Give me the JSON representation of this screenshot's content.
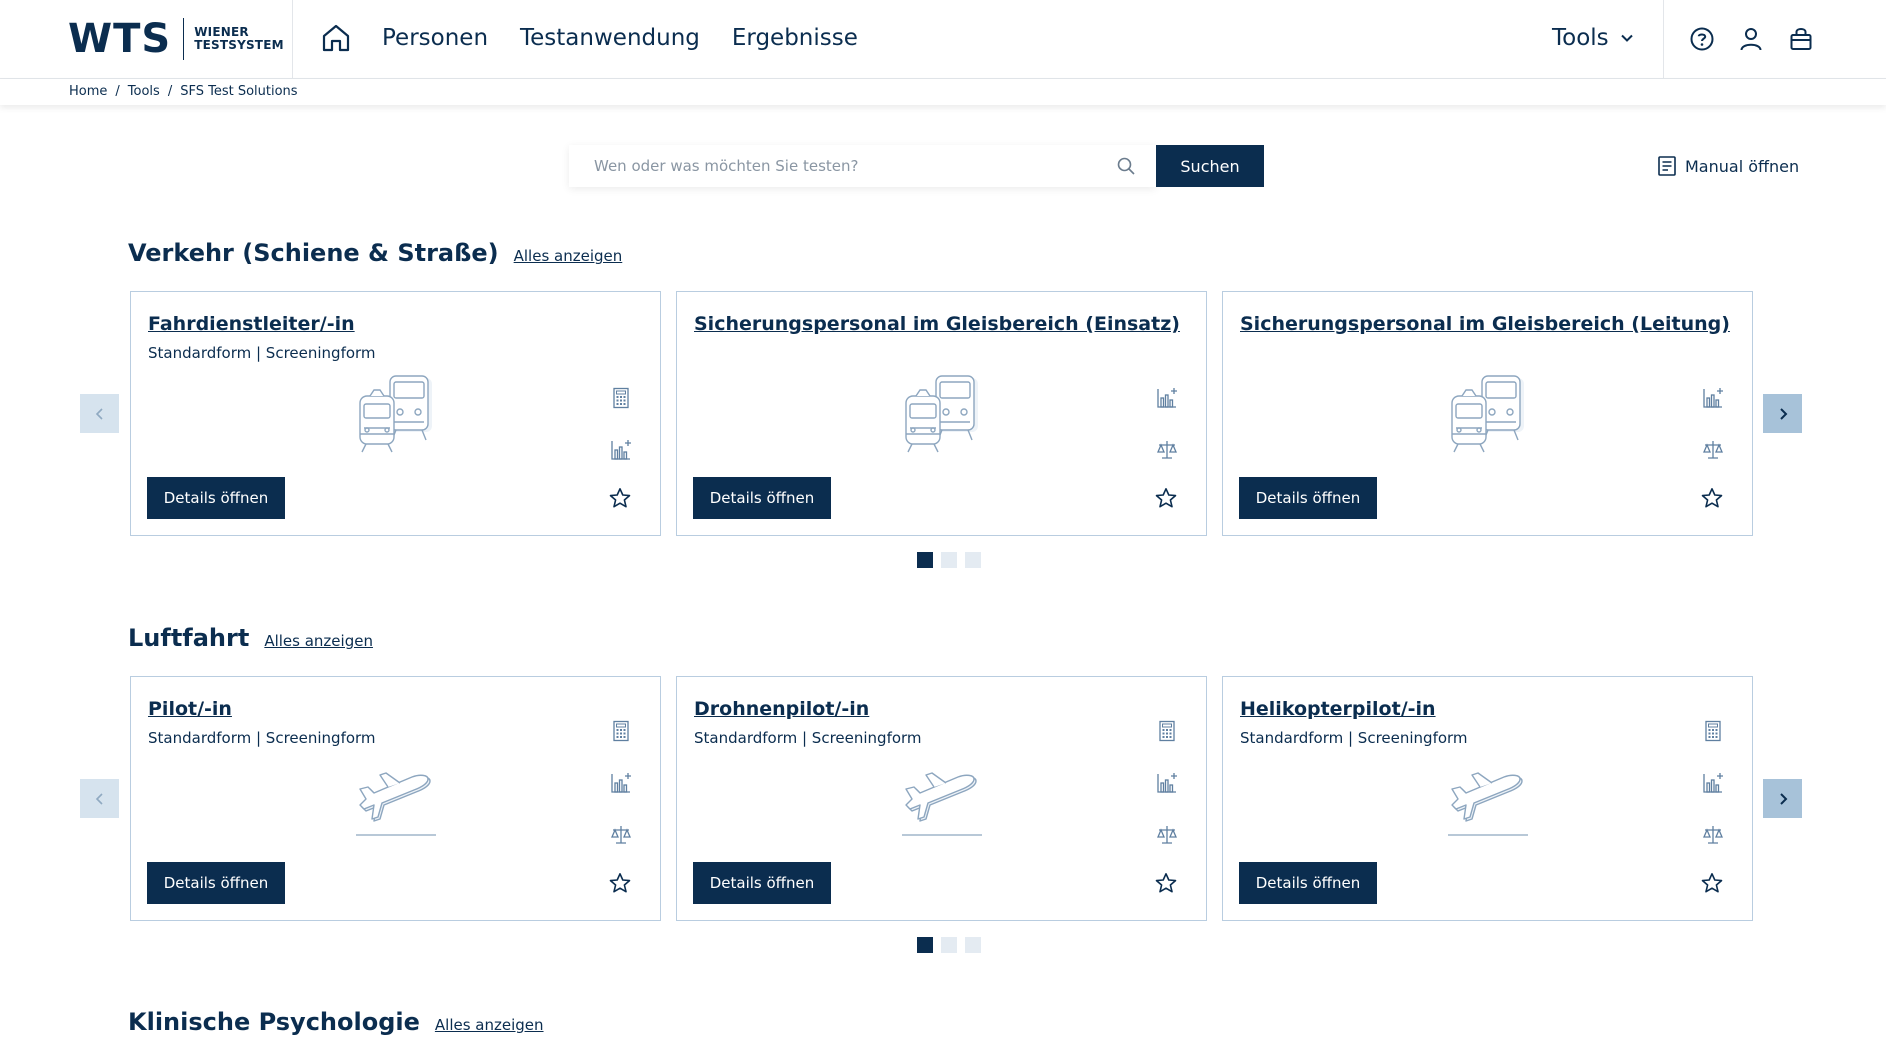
{
  "header": {
    "logo_main": "WTS",
    "logo_sub_line1": "WIENER",
    "logo_sub_line2": "TESTSYSTEM",
    "nav": [
      "Personen",
      "Testanwendung",
      "Ergebnisse"
    ],
    "tools_label": "Tools",
    "icons": [
      "home-icon",
      "help-icon",
      "user-icon",
      "cart-icon",
      "chevron-down-icon"
    ]
  },
  "breadcrumb": {
    "items": [
      "Home",
      "Tools",
      "SFS Test Solutions"
    ],
    "separator": "/"
  },
  "search": {
    "placeholder": "Wen oder was möchten Sie testen?",
    "value": "",
    "button_label": "Suchen",
    "manual_label": "Manual öffnen"
  },
  "colors": {
    "primary": "#0b2d4f",
    "card_border": "#b9cde0",
    "arrow_prev_bg": "#d6e3ee",
    "arrow_next_bg": "#a7c2d9",
    "dot_inactive": "#e4ebf2"
  },
  "sections": [
    {
      "title": "Verkehr (Schiene & Straße)",
      "link": "Alles anzeigen",
      "active_page": 1,
      "page_count": 3,
      "cards": [
        {
          "title": "Fahrdienstleiter/-in",
          "subtitle": "Standardform | Screeningform",
          "image": "train-icon",
          "button": "Details öffnen",
          "icons": [
            "document-icon",
            "chart-plus-icon"
          ]
        },
        {
          "title": "Sicherungspersonal im Gleisbereich (Einsatz)",
          "subtitle": "",
          "image": "train-icon",
          "button": "Details öffnen",
          "icons": [
            "chart-plus-icon",
            "scales-icon"
          ]
        },
        {
          "title": "Sicherungspersonal im Gleisbereich (Leitung)",
          "subtitle": "",
          "image": "train-icon",
          "button": "Details öffnen",
          "icons": [
            "chart-plus-icon",
            "scales-icon"
          ]
        }
      ]
    },
    {
      "title": "Luftfahrt",
      "link": "Alles anzeigen",
      "active_page": 1,
      "page_count": 3,
      "cards": [
        {
          "title": "Pilot/-in",
          "subtitle": "Standardform | Screeningform",
          "image": "airplane-icon",
          "button": "Details öffnen",
          "icons": [
            "document-icon",
            "chart-plus-icon",
            "scales-icon"
          ]
        },
        {
          "title": "Drohnenpilot/-in",
          "subtitle": "Standardform | Screeningform",
          "image": "airplane-icon",
          "button": "Details öffnen",
          "icons": [
            "document-icon",
            "chart-plus-icon",
            "scales-icon"
          ]
        },
        {
          "title": "Helikopterpilot/-in",
          "subtitle": "Standardform | Screeningform",
          "image": "airplane-icon",
          "button": "Details öffnen",
          "icons": [
            "document-icon",
            "chart-plus-icon",
            "scales-icon"
          ]
        }
      ]
    },
    {
      "title": "Klinische Psychologie",
      "link": "Alles anzeigen"
    }
  ]
}
